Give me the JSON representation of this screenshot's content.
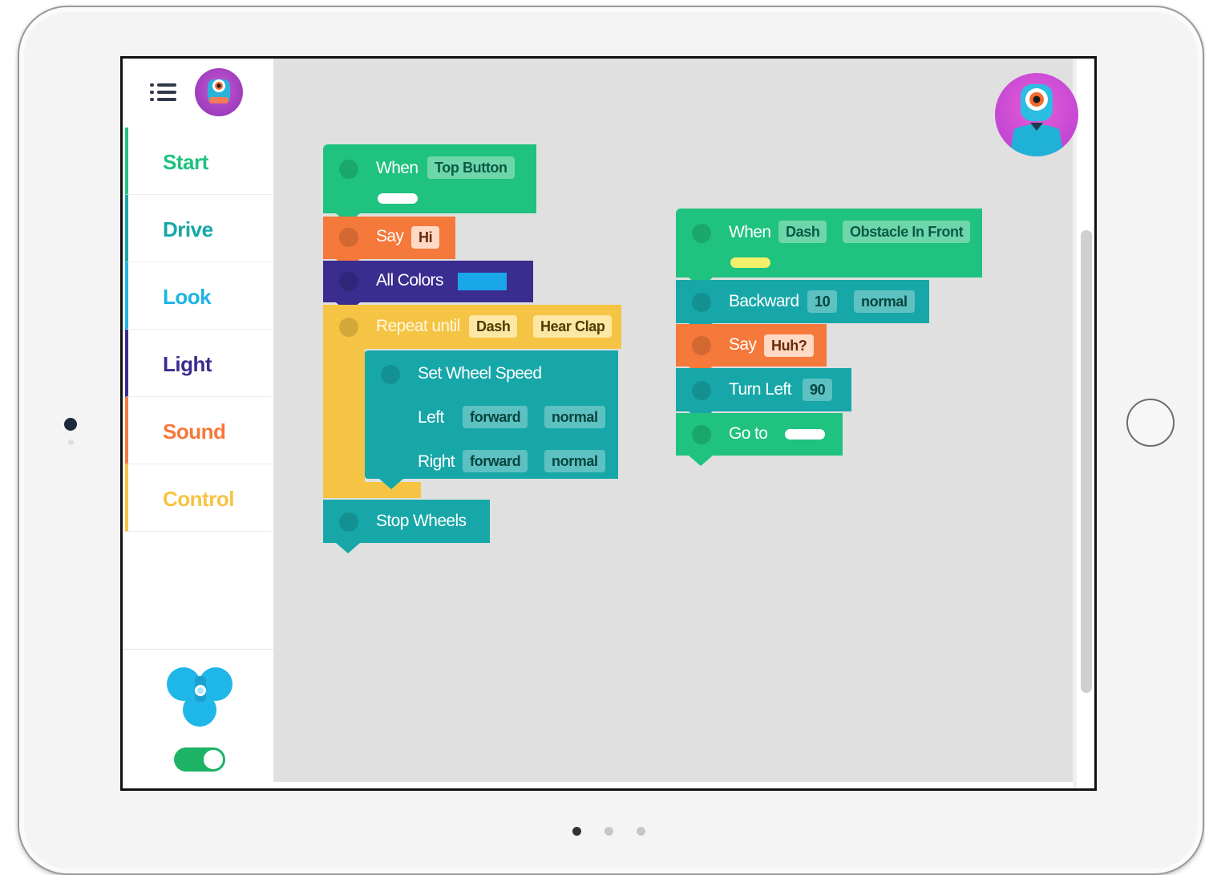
{
  "sidebar": {
    "categories": [
      {
        "label": "Start",
        "color": "#1fc27f"
      },
      {
        "label": "Drive",
        "color": "#17a7a8"
      },
      {
        "label": "Look",
        "color": "#1cb4e4"
      },
      {
        "label": "Light",
        "color": "#3a2d8f"
      },
      {
        "label": "Sound",
        "color": "#f5793a"
      },
      {
        "label": "Control",
        "color": "#f6c444"
      }
    ],
    "connection_toggle": {
      "state": "on",
      "color": "#1db364"
    }
  },
  "script_one": {
    "when": {
      "label": "When",
      "event": "Top Button"
    },
    "say": {
      "label": "Say",
      "value": "Hi"
    },
    "all_colors": {
      "label": "All Colors",
      "swatch": "#1aa7ea"
    },
    "repeat_until": {
      "label": "Repeat until",
      "robot": "Dash",
      "condition": "Hear Clap"
    },
    "set_wheel_speed": {
      "label": "Set Wheel Speed",
      "left_label": "Left",
      "left_direction": "forward",
      "left_speed": "normal",
      "right_label": "Right",
      "right_direction": "forward",
      "right_speed": "normal"
    },
    "stop_wheels": {
      "label": "Stop Wheels"
    }
  },
  "script_two": {
    "when": {
      "label": "When",
      "robot": "Dash",
      "event": "Obstacle In Front"
    },
    "backward": {
      "label": "Backward",
      "distance": "10",
      "speed": "normal"
    },
    "say": {
      "label": "Say",
      "value": "Huh?"
    },
    "turn_left": {
      "label": "Turn Left",
      "degrees": "90"
    },
    "go_to": {
      "label": "Go to"
    }
  },
  "colors": {
    "start": "#1fc27f",
    "drive": "#17a7a8",
    "light": "#3a2d8f",
    "sound": "#f5793a",
    "control": "#f6c444",
    "canvas": "#e0e0e0"
  },
  "pager": {
    "active_index": 0,
    "count": 3
  }
}
